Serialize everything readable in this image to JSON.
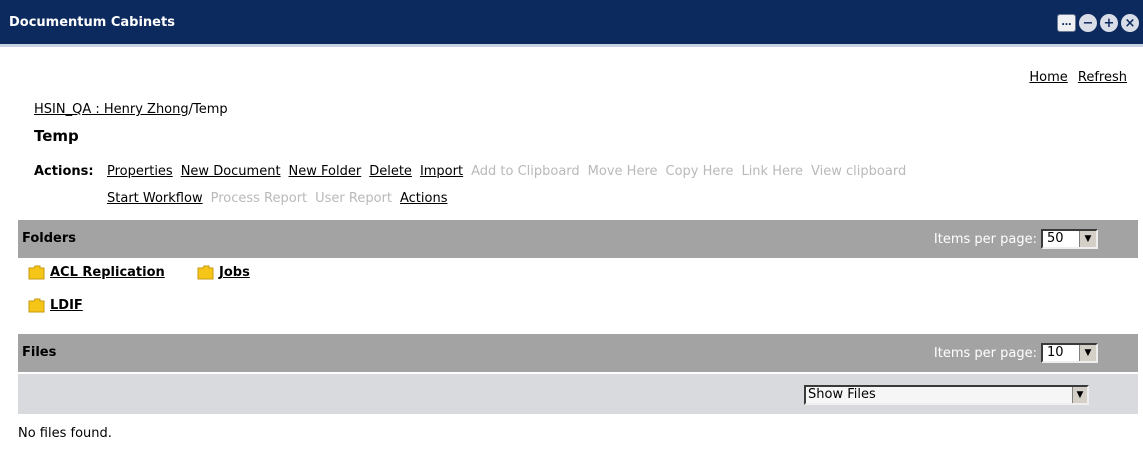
{
  "window": {
    "title": "Documentum Cabinets",
    "buttons": [
      {
        "name": "menu",
        "glyph": "…"
      },
      {
        "name": "minimize",
        "glyph": "−"
      },
      {
        "name": "add",
        "glyph": "+"
      },
      {
        "name": "close",
        "glyph": "×"
      }
    ]
  },
  "toplinks": {
    "home": "Home",
    "refresh": "Refresh"
  },
  "breadcrumb": {
    "root": "HSIN_QA : Henry Zhong",
    "current": "/Temp"
  },
  "page_title": "Temp",
  "actions": {
    "label": "Actions:",
    "row1": [
      {
        "label": "Properties",
        "enabled": true
      },
      {
        "label": "New Document",
        "enabled": true
      },
      {
        "label": "New Folder",
        "enabled": true
      },
      {
        "label": "Delete",
        "enabled": true
      },
      {
        "label": "Import",
        "enabled": true
      },
      {
        "label": "Add to Clipboard",
        "enabled": false
      },
      {
        "label": "Move Here",
        "enabled": false
      },
      {
        "label": "Copy Here",
        "enabled": false
      },
      {
        "label": "Link Here",
        "enabled": false
      },
      {
        "label": "View clipboard",
        "enabled": false
      }
    ],
    "row2": [
      {
        "label": "Start Workflow",
        "enabled": true
      },
      {
        "label": "Process Report",
        "enabled": false
      },
      {
        "label": "User Report",
        "enabled": false
      },
      {
        "label": "Actions",
        "enabled": true
      }
    ]
  },
  "folders_section": {
    "title": "Folders",
    "items_per_page_label": "Items per page:",
    "items_per_page": "50",
    "folders": [
      "ACL Replication",
      "Jobs",
      "LDIF"
    ]
  },
  "files_section": {
    "title": "Files",
    "items_per_page_label": "Items per page:",
    "items_per_page": "10",
    "filter": "Show Files",
    "empty_message": "No files found."
  },
  "colors": {
    "titlebar": "#0d2a5e",
    "section_bar": "#a3a3a3",
    "filter_bar": "#d8dadd",
    "disabled_action": "#b9b9b9",
    "folder_icon": "#f5c518"
  }
}
